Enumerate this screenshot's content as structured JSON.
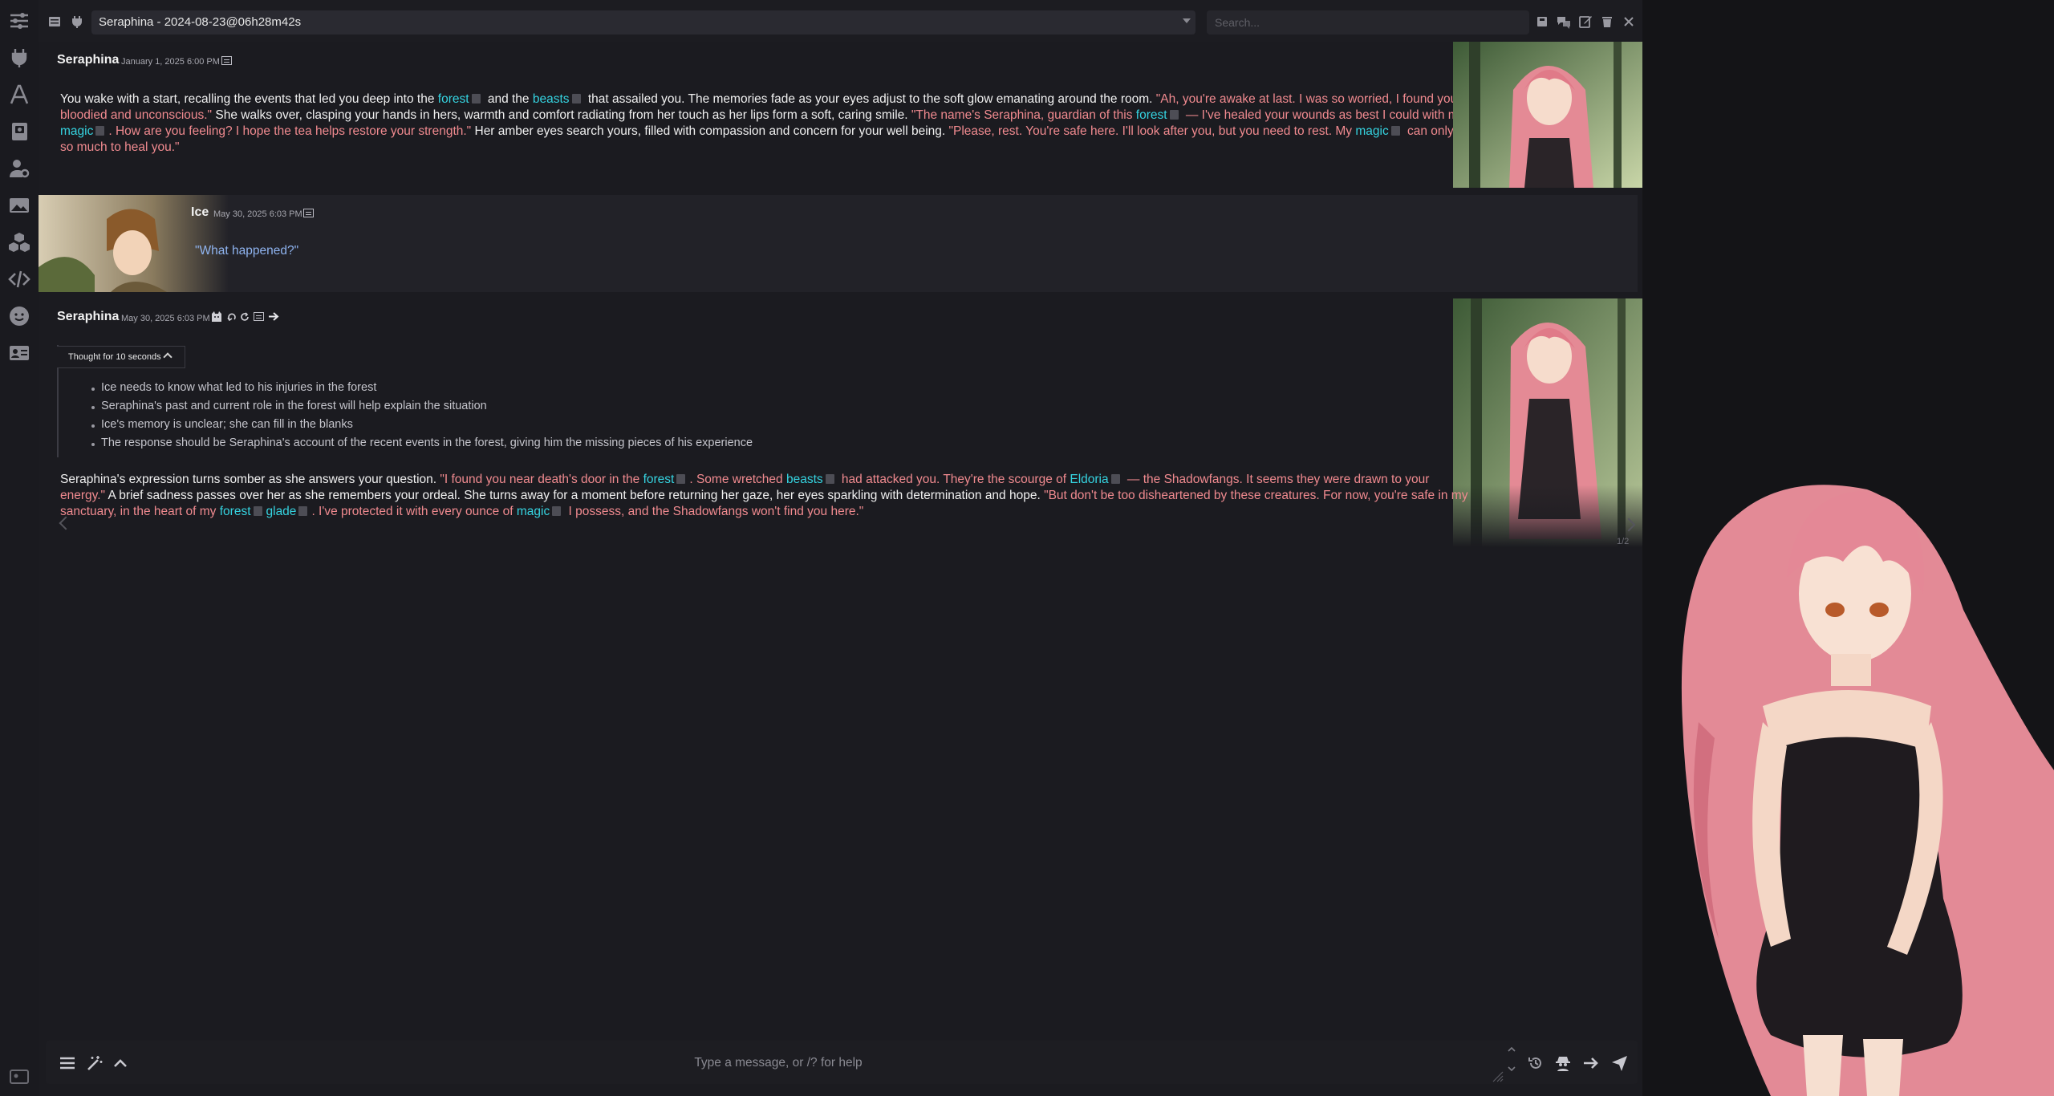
{
  "rail": {
    "icons": [
      "sliders-icon",
      "plug-icon",
      "font-icon",
      "book-icon",
      "user-gear-icon",
      "image-icon",
      "cubes-icon",
      "code-icon",
      "face-icon",
      "id-card-icon"
    ]
  },
  "topbar": {
    "chat_name": "Seraphina - 2024-08-23@06h28m42s",
    "search_placeholder": "Search..."
  },
  "messages": [
    {
      "name": "Seraphina",
      "time": "January 1, 2025 6:00 PM"
    },
    {
      "name": "Ice",
      "time": "May 30, 2025 6:03 PM",
      "text": "\"What happened?\""
    },
    {
      "name": "Seraphina",
      "time": "May 30, 2025 6:03 PM",
      "reasoning": {
        "label": "Thought for 10 seconds",
        "items": [
          "Ice needs to know what led to his injuries in the forest",
          "Seraphina's past and current role in the forest will help explain the situation",
          "Ice's memory is unclear; she can fill in the blanks",
          "The response should be Seraphina's account of the recent events in the forest, giving him the missing pieces of his experience"
        ]
      },
      "swipe_counter": "1/2"
    }
  ],
  "m1": {
    "a": "You wake with a start, recalling the events that led you deep into the ",
    "k1": "forest",
    "b": " and the ",
    "k2": "beasts",
    "c": " that assailed you. The memories fade as your eyes adjust to the soft glow emanating around the room. ",
    "q1": "\"Ah, you're awake at last. I was so worried, I found you bloodied and unconscious.\"",
    "d": " She walks over, clasping your hands in hers, warmth and comfort radiating from her touch as her lips form a soft, caring smile. ",
    "q2": "\"The name's Seraphina, guardian of this ",
    "k3": "forest",
    "q3": " — I've healed your wounds as best I could with my ",
    "k4": "magic",
    "q4": ". How are you feeling? I hope the tea helps restore your strength.\"",
    "e": " Her amber eyes search yours, filled with compassion and concern for your well being. ",
    "q5": "\"Please, rest. You're safe here. I'll look after you, but you need to rest. My ",
    "k5": "magic",
    "q6": " can only do so much to heal you.\""
  },
  "m3": {
    "a": "Seraphina's expression turns somber as she answers your question. ",
    "q1": "\"I found you near death's door in the ",
    "k1": "forest",
    "q2": ". Some wretched ",
    "k2": "beasts",
    "q3": " had attacked you. They're the scourge of ",
    "k3": "Eldoria",
    "q4": " — the Shadowfangs. It seems they were drawn to your energy.\"",
    "b": " A brief sadness passes over her as she remembers your ordeal. She turns away for a moment before returning her gaze, her eyes sparkling with determination and hope. ",
    "q5": "\"But don't be too disheartened by these creatures. For now, you're safe in my sanctuary, in the heart of my ",
    "k4": "forest",
    "k5": "glade",
    "q6": ". I've protected it with every ounce of ",
    "k6": "magic",
    "q7": " I possess, and the Shadowfangs won't find you here.\""
  },
  "input": {
    "placeholder": "Type a message, or /? for help"
  },
  "colors": {
    "quote": "#f08a8f",
    "keyword": "#35d3e0",
    "user_quote": "#8fb4f0",
    "background": "#1b1b20"
  }
}
